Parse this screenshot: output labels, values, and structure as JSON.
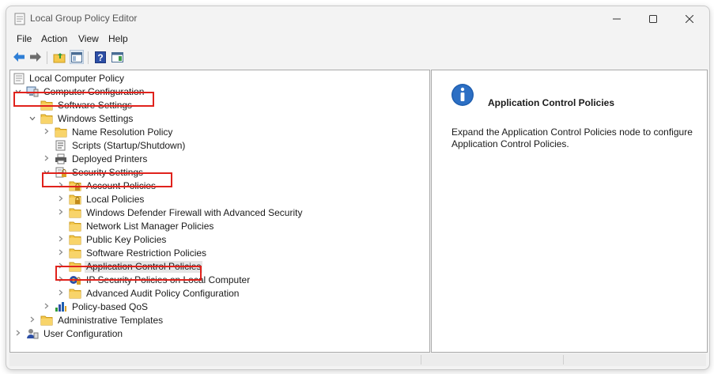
{
  "window": {
    "title": "Local Group Policy Editor",
    "controls": {
      "minimize": "—",
      "maximize": "☐",
      "close": "✕"
    }
  },
  "menu": [
    "File",
    "Action",
    "View",
    "Help"
  ],
  "toolbar": {
    "buttons": [
      "back-icon",
      "forward-icon",
      "up-folder-icon",
      "show-hide-console-tree-icon",
      "help-icon",
      "action-pane-icon"
    ]
  },
  "tree": {
    "root": "Local Computer Policy",
    "items": [
      {
        "label": "Computer Configuration",
        "expander": "open",
        "icon": "computer-icon"
      },
      {
        "label": "Software Settings",
        "expander": "none",
        "icon": "folder-icon"
      },
      {
        "label": "Windows Settings",
        "expander": "open",
        "icon": "folder-icon"
      },
      {
        "label": "Name Resolution Policy",
        "expander": "closed",
        "icon": "folder-icon"
      },
      {
        "label": "Scripts (Startup/Shutdown)",
        "expander": "none",
        "icon": "scripts-icon"
      },
      {
        "label": "Deployed Printers",
        "expander": "closed",
        "icon": "printer-icon"
      },
      {
        "label": "Security Settings",
        "expander": "open",
        "icon": "security-settings-icon"
      },
      {
        "label": "Account Policies",
        "expander": "closed",
        "icon": "locked-folder-icon"
      },
      {
        "label": "Local Policies",
        "expander": "closed",
        "icon": "locked-folder-icon"
      },
      {
        "label": "Windows Defender Firewall with Advanced Security",
        "expander": "closed",
        "icon": "folder-icon"
      },
      {
        "label": "Network List Manager Policies",
        "expander": "none",
        "icon": "folder-icon"
      },
      {
        "label": "Public Key Policies",
        "expander": "closed",
        "icon": "folder-icon"
      },
      {
        "label": "Software Restriction Policies",
        "expander": "closed",
        "icon": "folder-icon"
      },
      {
        "label": "Application Control Policies",
        "expander": "closed",
        "icon": "folder-icon",
        "selected": true
      },
      {
        "label": "IP Security Policies on Local Computer",
        "expander": "closed",
        "icon": "ip-security-icon"
      },
      {
        "label": "Advanced Audit Policy Configuration",
        "expander": "closed",
        "icon": "folder-icon"
      },
      {
        "label": "Policy-based QoS",
        "expander": "closed",
        "icon": "qos-chart-icon"
      },
      {
        "label": "Administrative Templates",
        "expander": "closed",
        "icon": "folder-icon"
      },
      {
        "label": "User Configuration",
        "expander": "closed",
        "icon": "user-icon"
      }
    ]
  },
  "details": {
    "title": "Application Control Policies",
    "description": "Expand the Application Control Policies node to configure Application Control Policies."
  },
  "colors": {
    "highlight": "#e0221c",
    "folder": "#f5c84c",
    "accent": "#1f5fb0"
  }
}
